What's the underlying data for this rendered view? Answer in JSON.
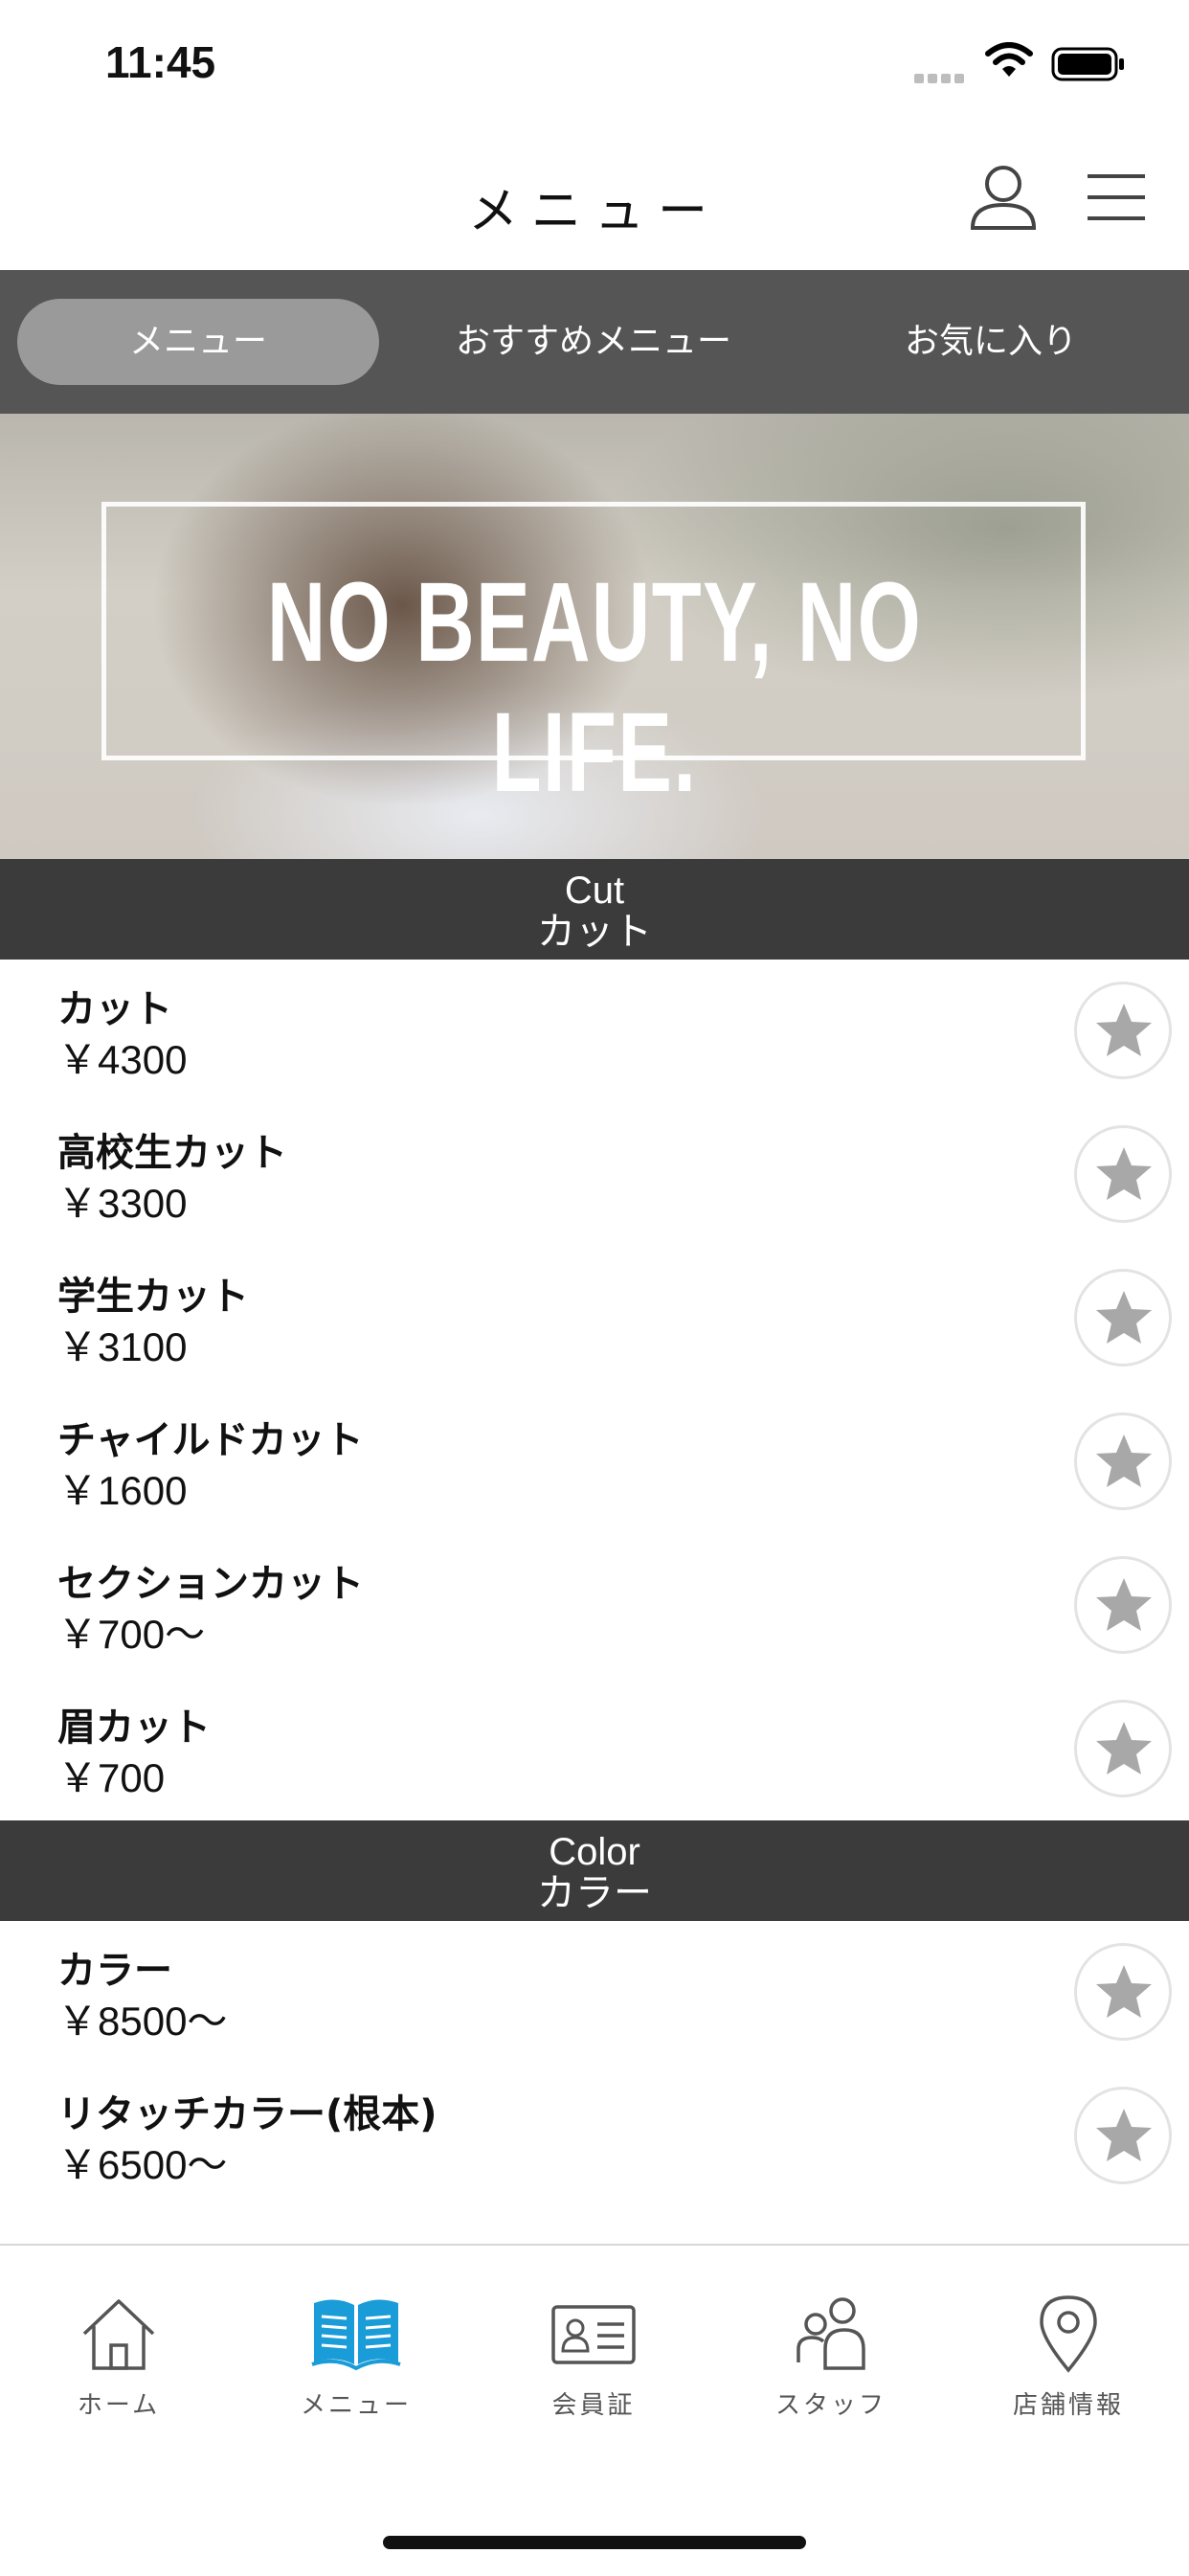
{
  "status_bar": {
    "time": "11:45"
  },
  "header": {
    "title": "メニュー"
  },
  "tabs": [
    {
      "label": "メニュー",
      "active": true
    },
    {
      "label": "おすすめメニュー",
      "active": false
    },
    {
      "label": "お気に入り",
      "active": false
    }
  ],
  "banner": {
    "text": "NO BEAUTY, NO LIFE."
  },
  "sections": [
    {
      "title_en": "Cut",
      "title_ja": "カット",
      "items": [
        {
          "name": "カット",
          "price": "￥4300"
        },
        {
          "name": "高校生カット",
          "price": "￥3300"
        },
        {
          "name": "学生カット",
          "price": "￥3100"
        },
        {
          "name": "チャイルドカット",
          "price": "￥1600"
        },
        {
          "name": "セクションカット",
          "price": "￥700〜"
        },
        {
          "name": "眉カット",
          "price": "￥700"
        }
      ]
    },
    {
      "title_en": "Color",
      "title_ja": "カラー",
      "items": [
        {
          "name": "カラー",
          "price": "￥8500〜"
        },
        {
          "name": "リタッチカラー(根本)",
          "price": "￥6500〜"
        }
      ]
    }
  ],
  "tab_bar": [
    {
      "label": "ホーム",
      "icon": "home-icon",
      "active": false
    },
    {
      "label": "メニュー",
      "icon": "book-icon",
      "active": true
    },
    {
      "label": "会員証",
      "icon": "member-card-icon",
      "active": false
    },
    {
      "label": "スタッフ",
      "icon": "staff-icon",
      "active": false
    },
    {
      "label": "店舗情報",
      "icon": "location-pin-icon",
      "active": false
    }
  ],
  "colors": {
    "accent": "#1a9cd8",
    "tab_bg": "#555555",
    "section_bg": "#3b3b3b",
    "star": "#a8a8a8"
  }
}
